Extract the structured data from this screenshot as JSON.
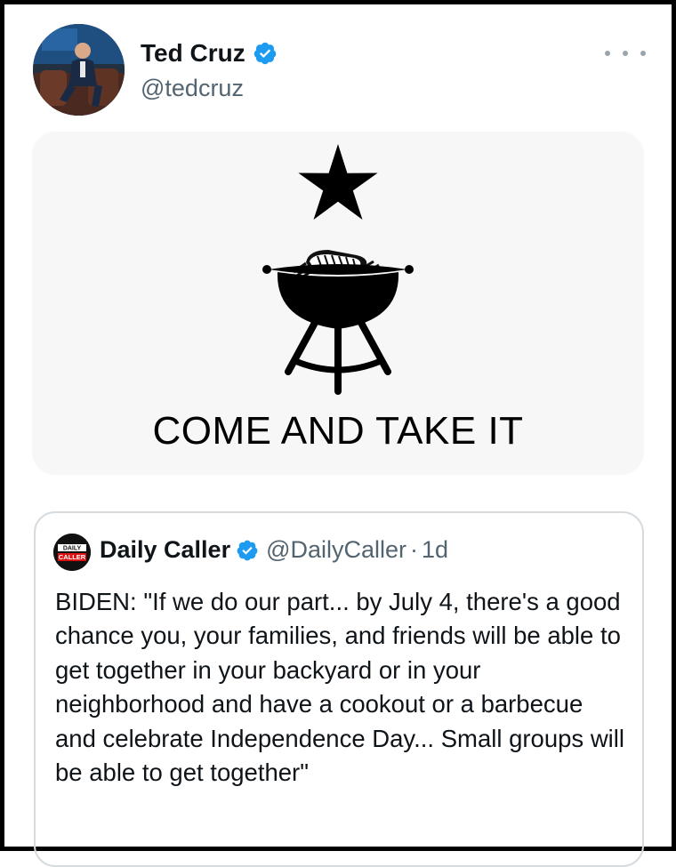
{
  "tweet": {
    "author": {
      "name": "Ted Cruz",
      "handle": "@tedcruz",
      "verified": true
    },
    "more_icon": "ellipsis-icon",
    "media": {
      "caption": "COME AND TAKE IT",
      "icons": [
        "star-icon",
        "grill-icon"
      ]
    }
  },
  "quoted": {
    "logo_lines": [
      "DAILY",
      "CALLER"
    ],
    "name": "Daily Caller",
    "handle": "@DailyCaller",
    "separator": "·",
    "time": "1d",
    "text": "BIDEN: \"If we do our part... by July 4, there's a good chance you, your families, and friends will be able to get together in your backyard or in your neighborhood and have a cookout or a barbecue and celebrate Independence Day... Small groups will be able to get together\""
  },
  "colors": {
    "verified_blue": "#1d9bf0",
    "text_primary": "#0f1419",
    "text_secondary": "#536471",
    "border": "#d6dbdf"
  }
}
